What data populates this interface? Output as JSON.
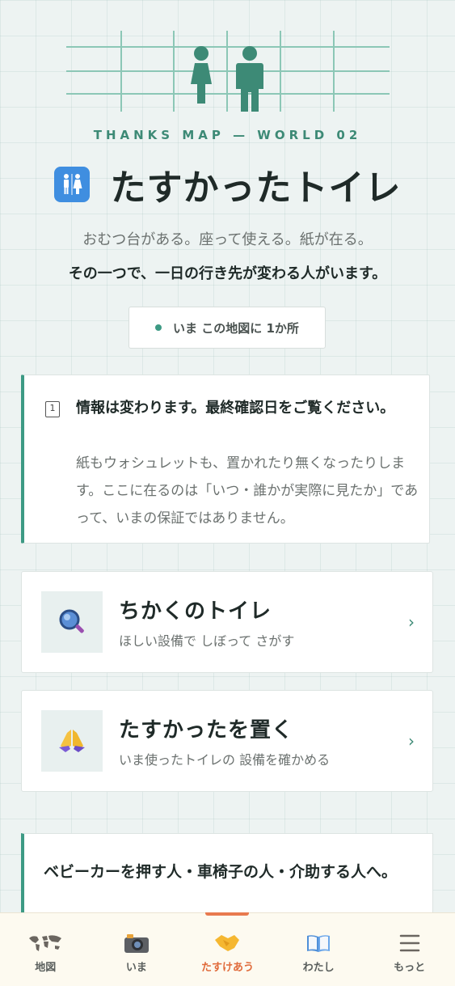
{
  "hero": {
    "eyebrow": "THANKS MAP — WORLD 02",
    "title": "たすかったトイレ",
    "title_icon": "restroom-icon",
    "lead_line1": "おむつ台がある。座って使える。紙が在る。",
    "lead_line2": "その一つで、一日の行き先が変わる人がいます。"
  },
  "count_badge": {
    "text": "いま この地図に 1か所"
  },
  "notice": {
    "icon": "calendar-icon",
    "icon_text": "1",
    "title": "情報は変わります。最終確認日をご覧ください。",
    "body": "紙もウォシュレットも、置かれたり無くなったりします。ここに在るのは「いつ・誰かが実際に見たか」であって、いまの保証ではありません。"
  },
  "nav_cards": [
    {
      "title": "ちかくのトイレ",
      "subtitle": "ほしい設備で しぼって さがす",
      "icon": "magnifier-icon",
      "chevron": "›"
    },
    {
      "title": "たすかったを置く",
      "subtitle": "いま使ったトイレの 設備を確かめる",
      "icon": "praying-hands-icon",
      "chevron": "›"
    }
  ],
  "audience": {
    "title": "ベビーカーを押す人・車椅子の人・介助する人へ。"
  },
  "tabbar": {
    "active": 2,
    "tabs": [
      {
        "label": "地図",
        "icon": "world-map-icon"
      },
      {
        "label": "いま",
        "icon": "camera-icon"
      },
      {
        "label": "たすけあう",
        "icon": "handshake-icon"
      },
      {
        "label": "わたし",
        "icon": "book-icon"
      },
      {
        "label": "もっと",
        "icon": "menu-icon"
      }
    ]
  },
  "colors": {
    "accent": "#3d9a84",
    "active_tab": "#e06a3a",
    "background": "#edf3f2"
  }
}
